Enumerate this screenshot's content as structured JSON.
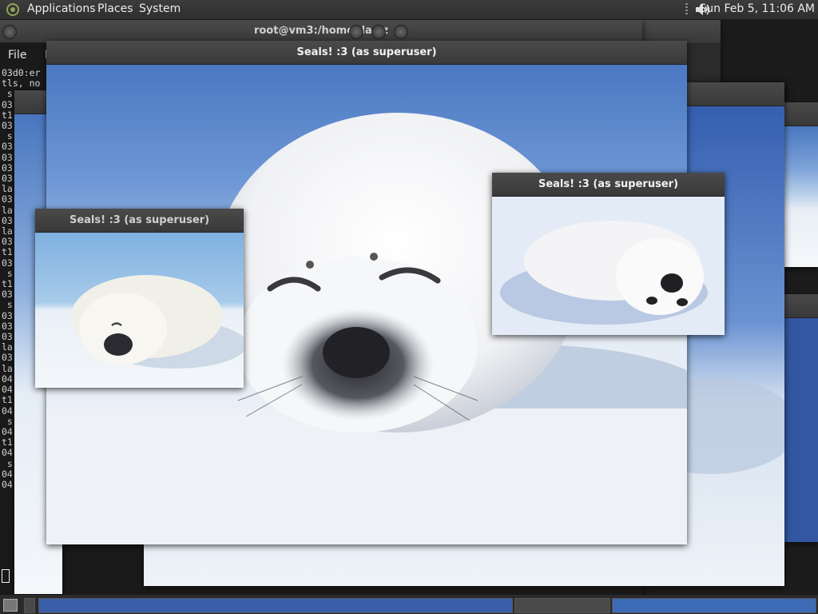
{
  "panel": {
    "menus": [
      "Applications",
      "Places",
      "System"
    ],
    "clock": "Sun Feb  5, 11:06 AM"
  },
  "terminal": {
    "title": "root@vm3:/home/dartz",
    "menu": [
      "File",
      "E"
    ],
    "lines": [
      "03d0:er",
      "tls, no",
      " s",
      "03",
      "t1",
      "03",
      " s",
      "03",
      "03",
      "03",
      "03",
      "la",
      "03",
      "la",
      "03",
      "la",
      "03",
      "t1",
      "03",
      " s",
      "t1",
      "03",
      " s",
      "03",
      "03",
      "03",
      "la",
      "03",
      "la",
      "04",
      "04",
      "t1",
      "04",
      " s",
      "04",
      "t1",
      "04",
      " s",
      "04",
      "04"
    ]
  },
  "windows": {
    "main_title": "Seals! :3 (as superuser)",
    "left_title": "Seals! :3 (as superuser)",
    "right_title": "Seals! :3 (as superuser)"
  },
  "colors": {
    "panel": "#333333",
    "titlebar": "#3f3f3f",
    "sky": "#4a78c0",
    "snow": "#f2f5f9"
  }
}
